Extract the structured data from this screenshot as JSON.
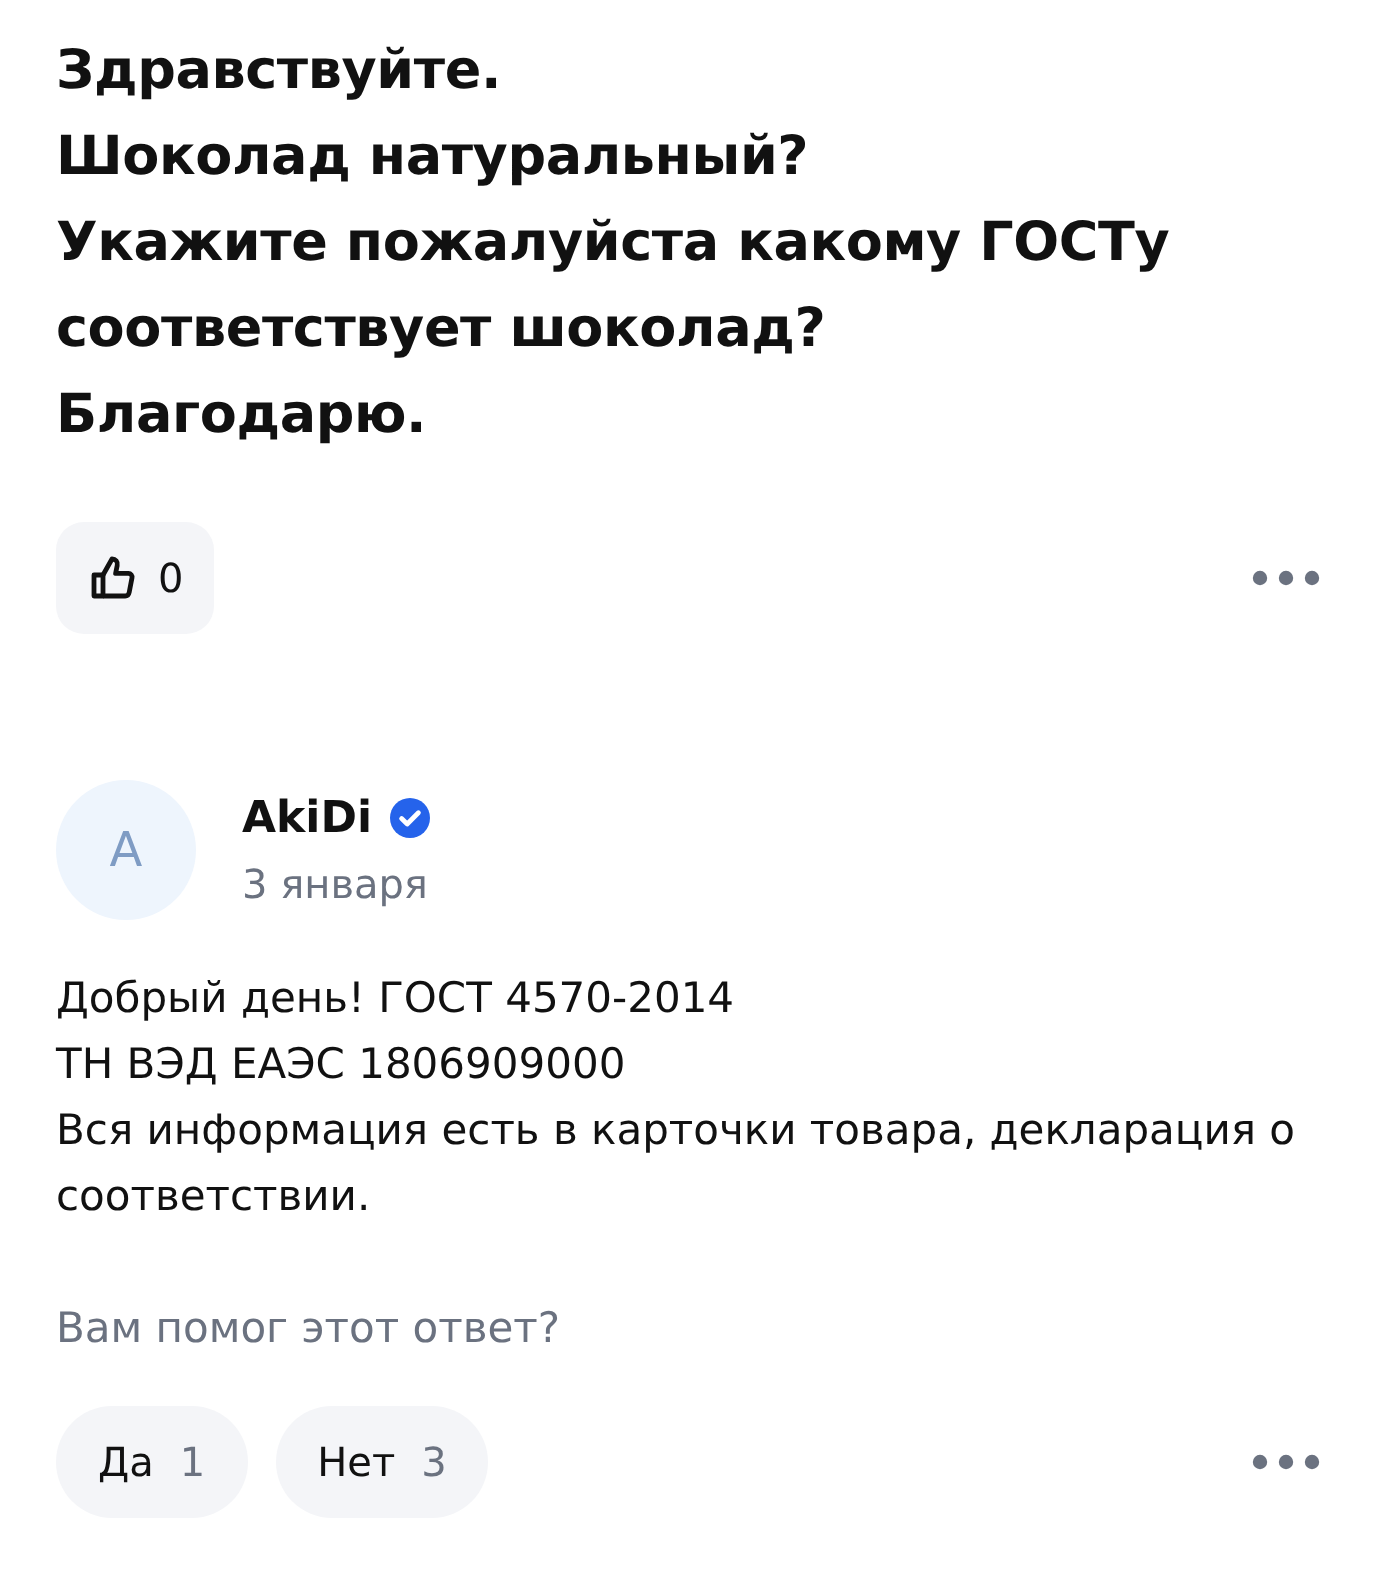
{
  "question": {
    "lines": [
      "Здравствуйте.",
      "Шоколад натуральный?",
      "Укажите пожалуйста какому ГОСТу",
      "соответствует шоколад?",
      "Благодарю."
    ],
    "like_count": "0"
  },
  "answer": {
    "avatar_letter": "A",
    "author": "AkiDi",
    "verified": true,
    "date": "3 января",
    "lines": [
      "Добрый день! ГОСТ 4570-2014",
      "ТН ВЭД ЕАЭС 1806909000",
      "Вся информация есть в карточки товара, декларация о соответствии."
    ]
  },
  "feedback": {
    "prompt": "Вам помог этот ответ?",
    "options": [
      {
        "label": "Да",
        "count": "1"
      },
      {
        "label": "Нет",
        "count": "3"
      }
    ]
  }
}
